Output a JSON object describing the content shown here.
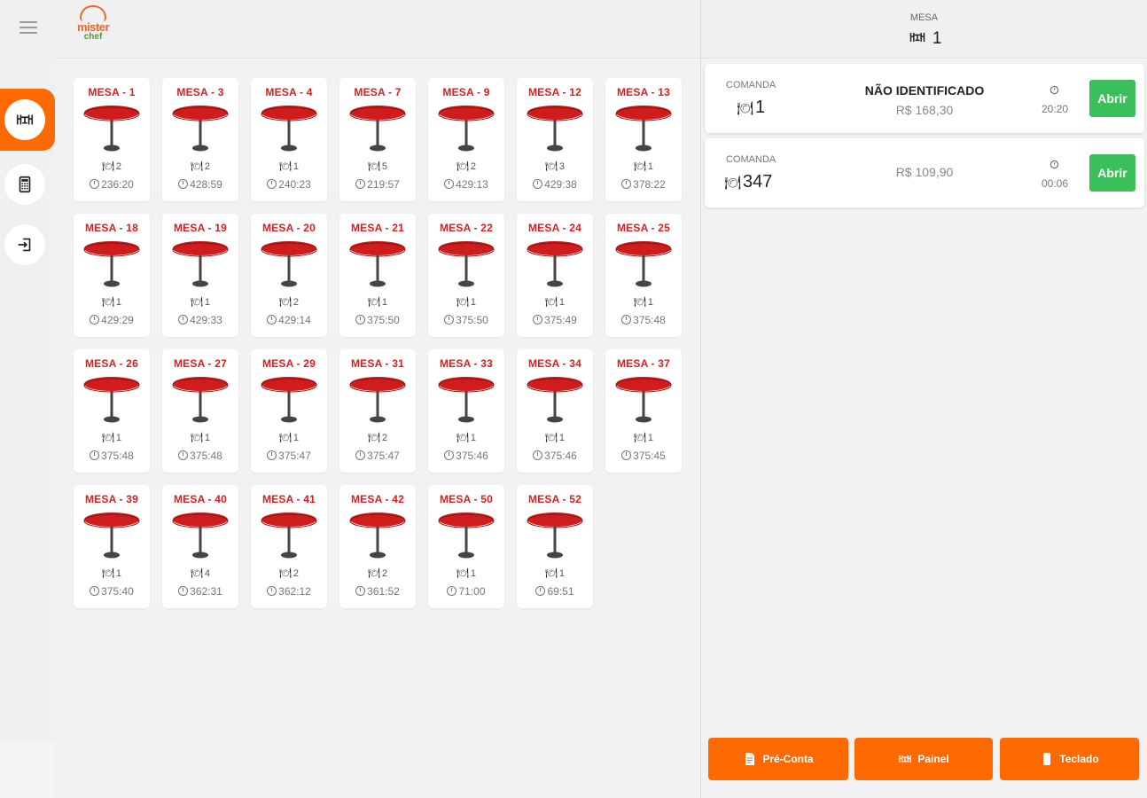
{
  "sidebar": {
    "items": [
      {
        "icon": "table-service-icon",
        "active": true
      },
      {
        "icon": "calculator-icon",
        "active": false
      },
      {
        "icon": "sign-in-icon",
        "active": false
      }
    ]
  },
  "logo": {
    "line1": "mister",
    "line2": "chef"
  },
  "tables": [
    {
      "name": "MESA - 1",
      "people": "2",
      "time": "236:20"
    },
    {
      "name": "MESA - 3",
      "people": "2",
      "time": "428:59"
    },
    {
      "name": "MESA - 4",
      "people": "1",
      "time": "240:23"
    },
    {
      "name": "MESA - 7",
      "people": "5",
      "time": "219:57"
    },
    {
      "name": "MESA - 9",
      "people": "2",
      "time": "429:13"
    },
    {
      "name": "MESA - 12",
      "people": "3",
      "time": "429:38"
    },
    {
      "name": "MESA - 13",
      "people": "1",
      "time": "378:22"
    },
    {
      "name": "MESA - 18",
      "people": "1",
      "time": "429:29"
    },
    {
      "name": "MESA - 19",
      "people": "1",
      "time": "429:33"
    },
    {
      "name": "MESA - 20",
      "people": "2",
      "time": "429:14"
    },
    {
      "name": "MESA - 21",
      "people": "1",
      "time": "375:50"
    },
    {
      "name": "MESA - 22",
      "people": "1",
      "time": "375:50"
    },
    {
      "name": "MESA - 24",
      "people": "1",
      "time": "375:49"
    },
    {
      "name": "MESA - 25",
      "people": "1",
      "time": "375:48"
    },
    {
      "name": "MESA - 26",
      "people": "1",
      "time": "375:48"
    },
    {
      "name": "MESA - 27",
      "people": "1",
      "time": "375:48"
    },
    {
      "name": "MESA - 29",
      "people": "1",
      "time": "375:47"
    },
    {
      "name": "MESA - 31",
      "people": "2",
      "time": "375:47"
    },
    {
      "name": "MESA - 33",
      "people": "1",
      "time": "375:46"
    },
    {
      "name": "MESA - 34",
      "people": "1",
      "time": "375:46"
    },
    {
      "name": "MESA - 37",
      "people": "1",
      "time": "375:45"
    },
    {
      "name": "MESA - 39",
      "people": "1",
      "time": "375:40"
    },
    {
      "name": "MESA - 40",
      "people": "4",
      "time": "362:31"
    },
    {
      "name": "MESA - 41",
      "people": "2",
      "time": "362:12"
    },
    {
      "name": "MESA - 42",
      "people": "2",
      "time": "361:52"
    },
    {
      "name": "MESA - 50",
      "people": "1",
      "time": "71:00"
    },
    {
      "name": "MESA - 52",
      "people": "1",
      "time": "69:51"
    }
  ],
  "panel": {
    "label": "MESA",
    "value": "1",
    "orders": [
      {
        "label": "COMANDA",
        "number": "1",
        "customer": "NÃO IDENTIFICADO",
        "price": "R$ 168,30",
        "time": "20:20",
        "action": "Abrir"
      },
      {
        "label": "COMANDA",
        "number": "347",
        "customer": "",
        "price": "R$ 109,90",
        "time": "00:06",
        "action": "Abrir"
      }
    ],
    "footer": [
      {
        "label": "Pré-Conta",
        "icon": "document-icon"
      },
      {
        "label": "Painel",
        "icon": "table-service-icon"
      },
      {
        "label": "Teclado",
        "icon": "keypad-icon"
      }
    ]
  },
  "colors": {
    "accent": "#ff6a00",
    "table_red": "#d42020",
    "open_green": "#3bbf5a"
  }
}
